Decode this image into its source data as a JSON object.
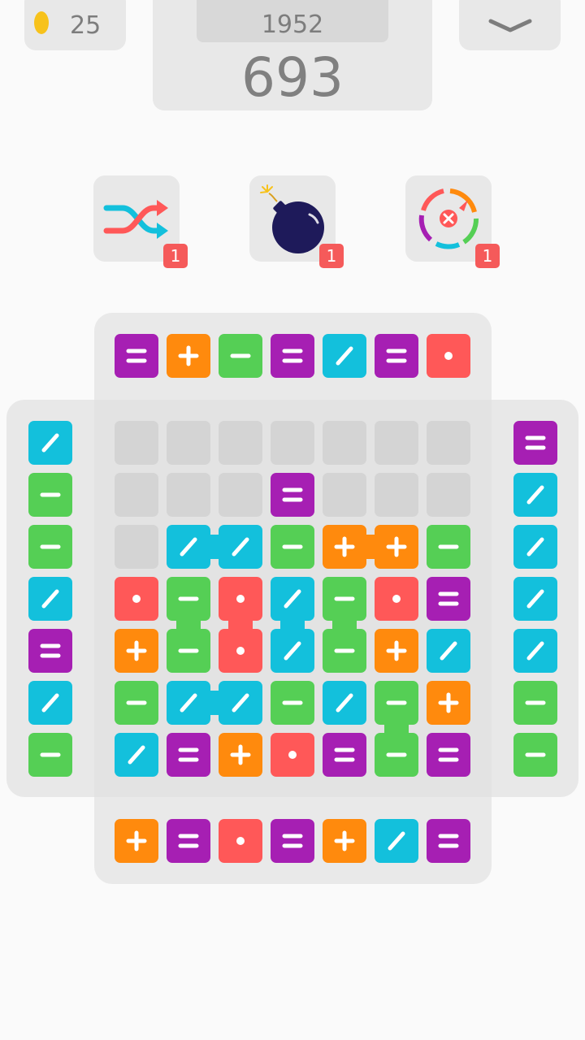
{
  "colors": {
    "equals": "#a61fb3",
    "plus": "#ff8a0d",
    "minus": "#55cf55",
    "divide": "#13c0dc",
    "dot": "#ff5858",
    "empty": "#d4d4d4"
  },
  "hud": {
    "coins": "25",
    "best_score": "1952",
    "score": "693",
    "menu_icon": "chevron-down-icon"
  },
  "powerups": [
    {
      "name": "shuffle",
      "icon": "shuffle-icon",
      "count": "1"
    },
    {
      "name": "bomb",
      "icon": "bomb-icon",
      "count": "1"
    },
    {
      "name": "color-wheel",
      "icon": "color-wheel-icon",
      "count": "1"
    }
  ],
  "board": {
    "top_queue": [
      "equals",
      "plus",
      "minus",
      "equals",
      "divide",
      "equals",
      "dot"
    ],
    "bottom_queue": [
      "plus",
      "equals",
      "dot",
      "equals",
      "plus",
      "divide",
      "equals"
    ],
    "left_queue": [
      "divide",
      "minus",
      "minus",
      "divide",
      "equals",
      "divide",
      "minus"
    ],
    "right_queue": [
      "equals",
      "divide",
      "divide",
      "divide",
      "divide",
      "minus",
      "minus"
    ],
    "grid": [
      [
        "empty",
        "empty",
        "empty",
        "empty",
        "empty",
        "empty",
        "empty"
      ],
      [
        "empty",
        "empty",
        "empty",
        "equals",
        "empty",
        "empty",
        "empty"
      ],
      [
        "empty",
        "divide",
        "divide",
        "minus",
        "plus",
        "plus",
        "minus"
      ],
      [
        "dot",
        "minus",
        "dot",
        "divide",
        "minus",
        "dot",
        "equals"
      ],
      [
        "plus",
        "minus",
        "dot",
        "divide",
        "minus",
        "plus",
        "divide"
      ],
      [
        "minus",
        "divide",
        "divide",
        "minus",
        "divide",
        "minus",
        "plus"
      ],
      [
        "divide",
        "equals",
        "plus",
        "dot",
        "equals",
        "minus",
        "equals"
      ]
    ]
  }
}
